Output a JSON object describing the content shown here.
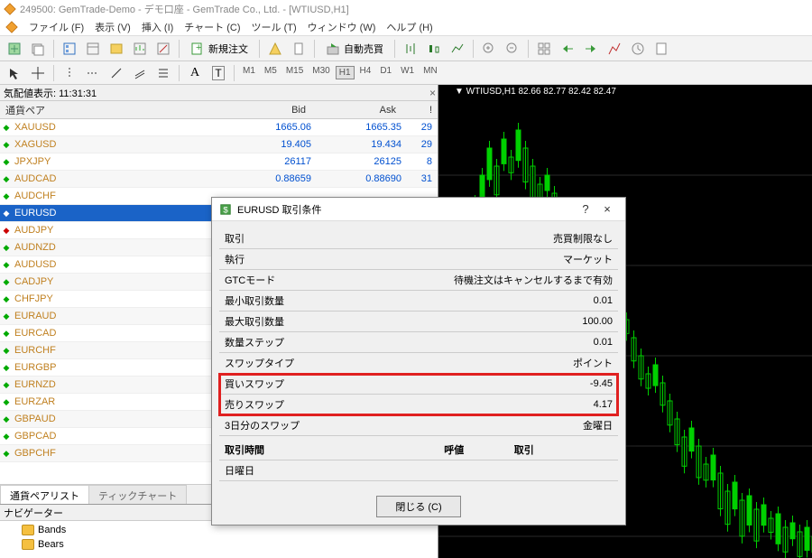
{
  "title": "249500: GemTrade-Demo - デモ口座 - GemTrade Co., Ltd. - [WTIUSD,H1]",
  "menu": {
    "file": "ファイル (F)",
    "view": "表示 (V)",
    "insert": "挿入 (I)",
    "chart": "チャート (C)",
    "tool": "ツール (T)",
    "window": "ウィンドウ (W)",
    "help": "ヘルプ (H)"
  },
  "toolbar": {
    "new_order": "新規注文",
    "auto_trade": "自動売買"
  },
  "timeframes": [
    "M1",
    "M5",
    "M15",
    "M30",
    "H1",
    "H4",
    "D1",
    "W1",
    "MN"
  ],
  "active_tf": "H1",
  "market_watch": {
    "title": "気配値表示: 11:31:31",
    "headers": {
      "symbol": "通貨ペア",
      "bid": "Bid",
      "ask": "Ask",
      "exc": "!"
    },
    "rows": [
      {
        "sym": "XAUUSD",
        "bid": "1665.06",
        "ask": "1665.35",
        "exc": "29",
        "dir": "up",
        "cls": "blue"
      },
      {
        "sym": "XAGUSD",
        "bid": "19.405",
        "ask": "19.434",
        "exc": "29",
        "dir": "up",
        "cls": "blue"
      },
      {
        "sym": "JPXJPY",
        "bid": "26117",
        "ask": "26125",
        "exc": "8",
        "dir": "up",
        "cls": "blue"
      },
      {
        "sym": "AUDCAD",
        "bid": "0.88659",
        "ask": "0.88690",
        "exc": "31",
        "dir": "up",
        "cls": "blue"
      },
      {
        "sym": "AUDCHF",
        "bid": "",
        "ask": "",
        "exc": "",
        "dir": "up",
        "cls": ""
      },
      {
        "sym": "EURUSD",
        "bid": "",
        "ask": "",
        "exc": "",
        "dir": "dn",
        "cls": "",
        "sel": true
      },
      {
        "sym": "AUDJPY",
        "bid": "",
        "ask": "",
        "exc": "",
        "dir": "dn",
        "cls": ""
      },
      {
        "sym": "AUDNZD",
        "bid": "",
        "ask": "",
        "exc": "",
        "dir": "up",
        "cls": ""
      },
      {
        "sym": "AUDUSD",
        "bid": "",
        "ask": "",
        "exc": "",
        "dir": "up",
        "cls": ""
      },
      {
        "sym": "CADJPY",
        "bid": "",
        "ask": "",
        "exc": "",
        "dir": "up",
        "cls": ""
      },
      {
        "sym": "CHFJPY",
        "bid": "",
        "ask": "",
        "exc": "",
        "dir": "up",
        "cls": ""
      },
      {
        "sym": "EURAUD",
        "bid": "",
        "ask": "",
        "exc": "",
        "dir": "up",
        "cls": ""
      },
      {
        "sym": "EURCAD",
        "bid": "",
        "ask": "",
        "exc": "",
        "dir": "up",
        "cls": ""
      },
      {
        "sym": "EURCHF",
        "bid": "",
        "ask": "",
        "exc": "",
        "dir": "up",
        "cls": ""
      },
      {
        "sym": "EURGBP",
        "bid": "",
        "ask": "",
        "exc": "",
        "dir": "up",
        "cls": ""
      },
      {
        "sym": "EURNZD",
        "bid": "",
        "ask": "",
        "exc": "",
        "dir": "up",
        "cls": ""
      },
      {
        "sym": "EURZAR",
        "bid": "",
        "ask": "",
        "exc": "",
        "dir": "up",
        "cls": ""
      },
      {
        "sym": "GBPAUD",
        "bid": "",
        "ask": "",
        "exc": "",
        "dir": "up",
        "cls": ""
      },
      {
        "sym": "GBPCAD",
        "bid": "",
        "ask": "",
        "exc": "",
        "dir": "up",
        "cls": ""
      },
      {
        "sym": "GBPCHF",
        "bid": "",
        "ask": "",
        "exc": "",
        "dir": "up",
        "cls": ""
      }
    ],
    "tabs": {
      "list": "通貨ペアリスト",
      "tick": "ティックチャート"
    }
  },
  "navigator": {
    "title": "ナビゲーター",
    "items": [
      "Bands",
      "Bears"
    ]
  },
  "chart": {
    "label": "▼ WTIUSD,H1  82.66 82.77 82.42 82.47"
  },
  "dialog": {
    "title": "EURUSD 取引条件",
    "rows": [
      {
        "k": "取引",
        "v": "売買制限なし"
      },
      {
        "k": "執行",
        "v": "マーケット"
      },
      {
        "k": "GTCモード",
        "v": "待機注文はキャンセルするまで有効"
      },
      {
        "k": "最小取引数量",
        "v": "0.01"
      },
      {
        "k": "最大取引数量",
        "v": "100.00"
      },
      {
        "k": "数量ステップ",
        "v": "0.01"
      },
      {
        "k": "スワップタイプ",
        "v": "ポイント"
      },
      {
        "k": "買いスワップ",
        "v": "-9.45",
        "hl": true
      },
      {
        "k": "売りスワップ",
        "v": "4.17",
        "hl": true
      },
      {
        "k": "3日分のスワップ",
        "v": "金曜日"
      }
    ],
    "header2": {
      "c1": "取引時間",
      "c2": "呼値",
      "c3": "取引"
    },
    "row2": {
      "c1": "日曜日",
      "c2": "",
      "c3": ""
    },
    "close_btn": "閉じる (C)"
  }
}
